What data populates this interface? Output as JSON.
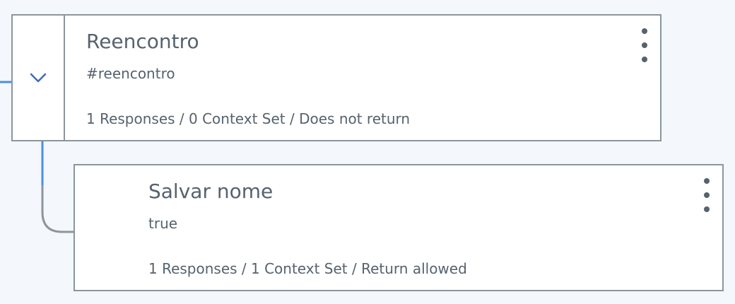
{
  "colors": {
    "background": "#f4f7fb",
    "card_border": "#8c959d",
    "text": "#56626d",
    "accent_blue": "#4a90e2",
    "chevron": "#3d6fb6"
  },
  "nodes": [
    {
      "title": "Reencontro",
      "condition": "#reencontro",
      "meta": "1 Responses / 0 Context Set / Does not return",
      "expanded": true,
      "toggle_icon": "chevron-down-icon",
      "menu_icon": "overflow-menu-icon"
    },
    {
      "title": "Salvar nome",
      "condition": "true",
      "meta": "1 Responses / 1 Context Set / Return allowed",
      "menu_icon": "overflow-menu-icon"
    }
  ]
}
